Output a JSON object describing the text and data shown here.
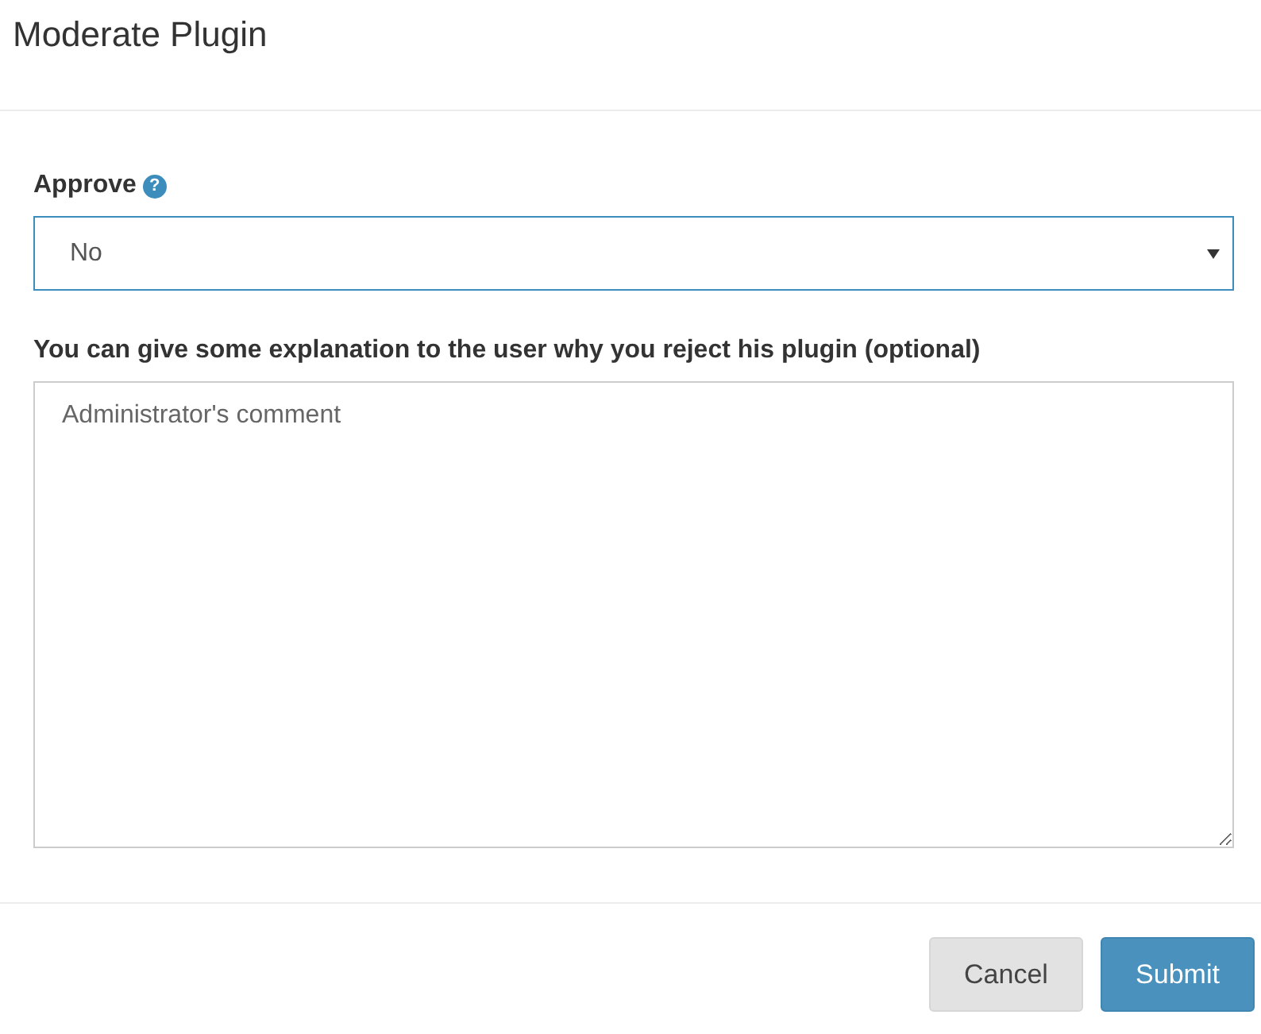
{
  "window": {
    "title": "Moderate Plugin"
  },
  "approve": {
    "label": "Approve",
    "help_glyph": "?",
    "value": "No",
    "focused": true
  },
  "explanation": {
    "label": "You can give some explanation to the user why you reject his plugin (optional)",
    "placeholder": "Administrator's comment"
  },
  "buttons": [
    {
      "label": "Cancel",
      "kind": "default"
    },
    {
      "label": "Submit",
      "kind": "primary"
    }
  ]
}
